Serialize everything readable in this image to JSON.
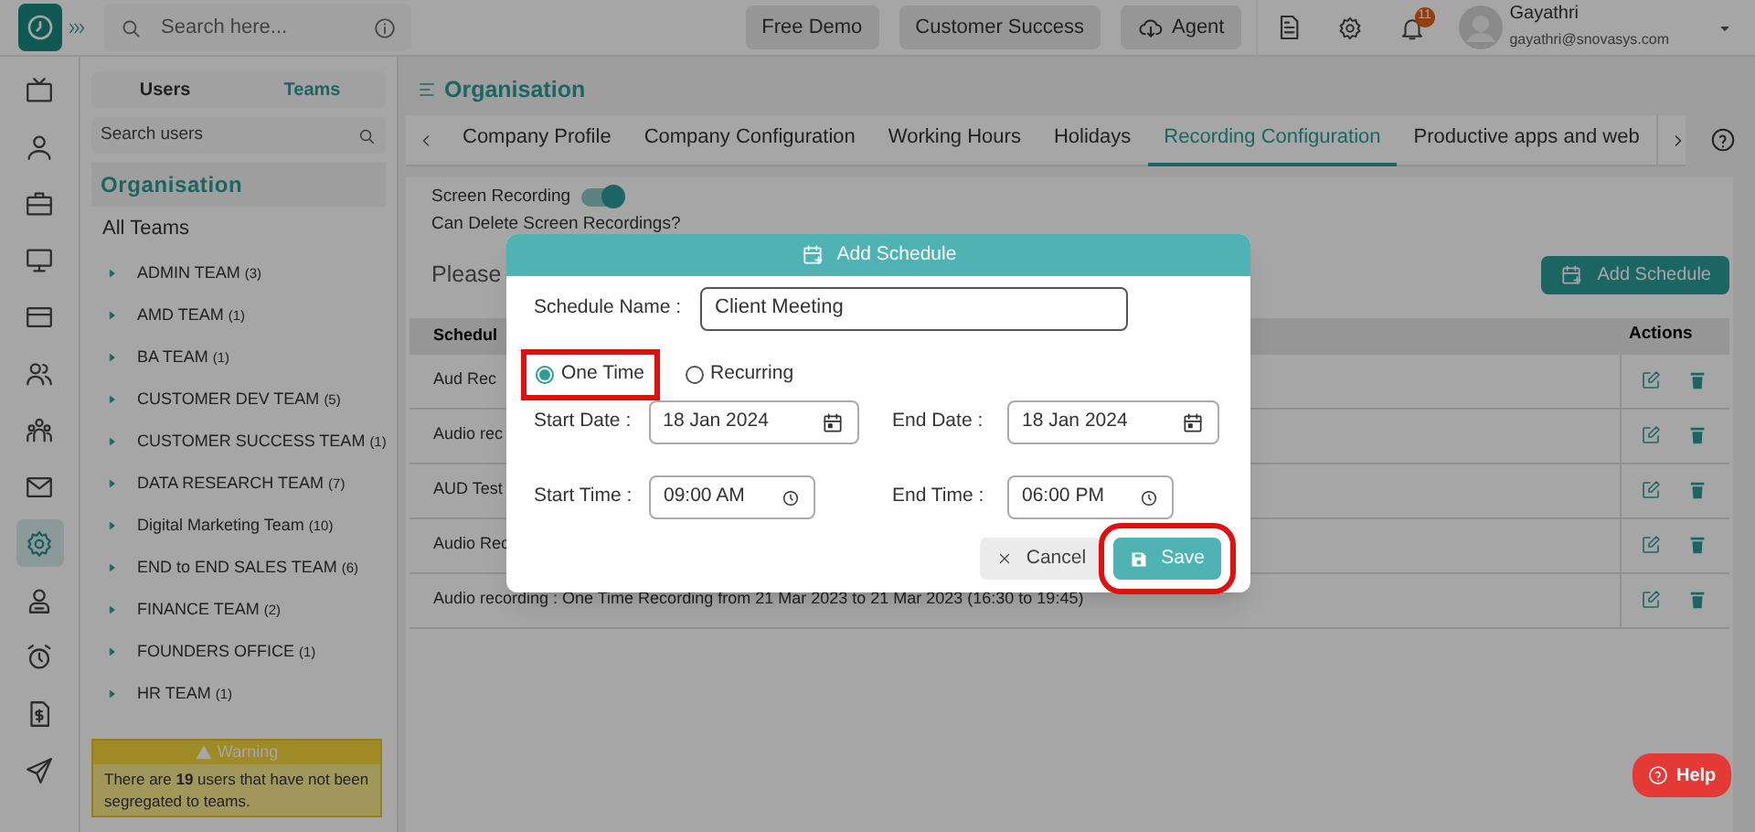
{
  "app_rail": {
    "items": [
      {
        "kind": "tv",
        "selected": false
      },
      {
        "kind": "user",
        "selected": false
      },
      {
        "kind": "briefcase",
        "selected": false
      },
      {
        "kind": "monitor",
        "selected": false
      },
      {
        "kind": "card",
        "selected": false
      },
      {
        "kind": "users",
        "selected": false
      },
      {
        "kind": "group",
        "selected": false
      },
      {
        "kind": "mail",
        "selected": false
      },
      {
        "kind": "gear",
        "selected": true
      },
      {
        "kind": "badge",
        "selected": false
      },
      {
        "kind": "alarm",
        "selected": false
      },
      {
        "kind": "invoice",
        "selected": false
      },
      {
        "kind": "send",
        "selected": false
      }
    ]
  },
  "top_bar": {
    "search": {
      "placeholder": "Search here..."
    },
    "buttons": [
      {
        "label": "Free Demo",
        "kind": "plain"
      },
      {
        "label": "Customer Success",
        "kind": "plain"
      },
      {
        "label": "Agent",
        "kind": "cloud"
      }
    ],
    "notification_count": "11",
    "user": {
      "name": "Gayathri",
      "email": "gayathri@snovasys.com"
    }
  },
  "team_panel": {
    "tabs": [
      {
        "label": "Users",
        "selected": false
      },
      {
        "label": "Teams",
        "selected": true
      }
    ],
    "search": {
      "placeholder": "Search users"
    },
    "heading": "Organisation",
    "all_teams": "All Teams",
    "teams": [
      {
        "name": "ADMIN TEAM",
        "count": "(3)"
      },
      {
        "name": "AMD TEAM",
        "count": "(1)"
      },
      {
        "name": "BA TEAM",
        "count": "(1)"
      },
      {
        "name": "CUSTOMER DEV TEAM",
        "count": "(5)"
      },
      {
        "name": "CUSTOMER SUCCESS TEAM",
        "count": "(1)"
      },
      {
        "name": "DATA RESEARCH TEAM",
        "count": "(7)"
      },
      {
        "name": "Digital Marketing Team",
        "count": "(10)"
      },
      {
        "name": "END to END SALES TEAM",
        "count": "(6)"
      },
      {
        "name": "FINANCE TEAM",
        "count": "(2)"
      },
      {
        "name": "FOUNDERS OFFICE",
        "count": "(1)"
      },
      {
        "name": "HR TEAM",
        "count": "(1)"
      }
    ],
    "warning": {
      "title": "Warning",
      "message": "There are **19** users that have not been segregated to teams."
    }
  },
  "page": {
    "title": "Organisation",
    "tabs": [
      {
        "label": "Company Profile",
        "selected": false
      },
      {
        "label": "Company Configuration",
        "selected": false
      },
      {
        "label": "Working Hours",
        "selected": false
      },
      {
        "label": "Holidays",
        "selected": false
      },
      {
        "label": "Recording Configuration",
        "selected": true
      },
      {
        "label": "Productive apps and web",
        "selected": false
      }
    ],
    "screen_recording": {
      "label": "Screen Recording",
      "on": true
    },
    "can_delete_label": "Can Delete Screen Recordings?",
    "notice": "Please",
    "add_button": "Add Schedule",
    "table": {
      "columns": [
        "Schedul",
        "Actions"
      ],
      "rows": [
        "Aud Rec",
        "Audio rec",
        "AUD Test",
        "Audio Rec",
        "Audio recording : One Time Recording from 21 Mar 2023 to 21 Mar 2023 (16:30 to 19:45)"
      ]
    }
  },
  "dialog": {
    "title": "Add Schedule",
    "name_label": "Schedule Name :",
    "name_value": "Client Meeting",
    "options": [
      {
        "label": "One Time",
        "selected": true,
        "highlighted": true
      },
      {
        "label": "Recurring",
        "selected": false,
        "highlighted": false
      }
    ],
    "fields": [
      {
        "label": "Start Date :",
        "value": "18 Jan 2024",
        "kind": "date"
      },
      {
        "label": "End Date :",
        "value": "18 Jan 2024",
        "kind": "date"
      },
      {
        "label": "Start Time :",
        "value": "09:00 AM",
        "kind": "time"
      },
      {
        "label": "End Time :",
        "value": "06:00 PM",
        "kind": "time"
      }
    ],
    "buttons": [
      {
        "label": "Cancel",
        "kind": "cancel",
        "highlighted": false
      },
      {
        "label": "Save",
        "kind": "save",
        "highlighted": true
      }
    ]
  },
  "help_button": "Help"
}
